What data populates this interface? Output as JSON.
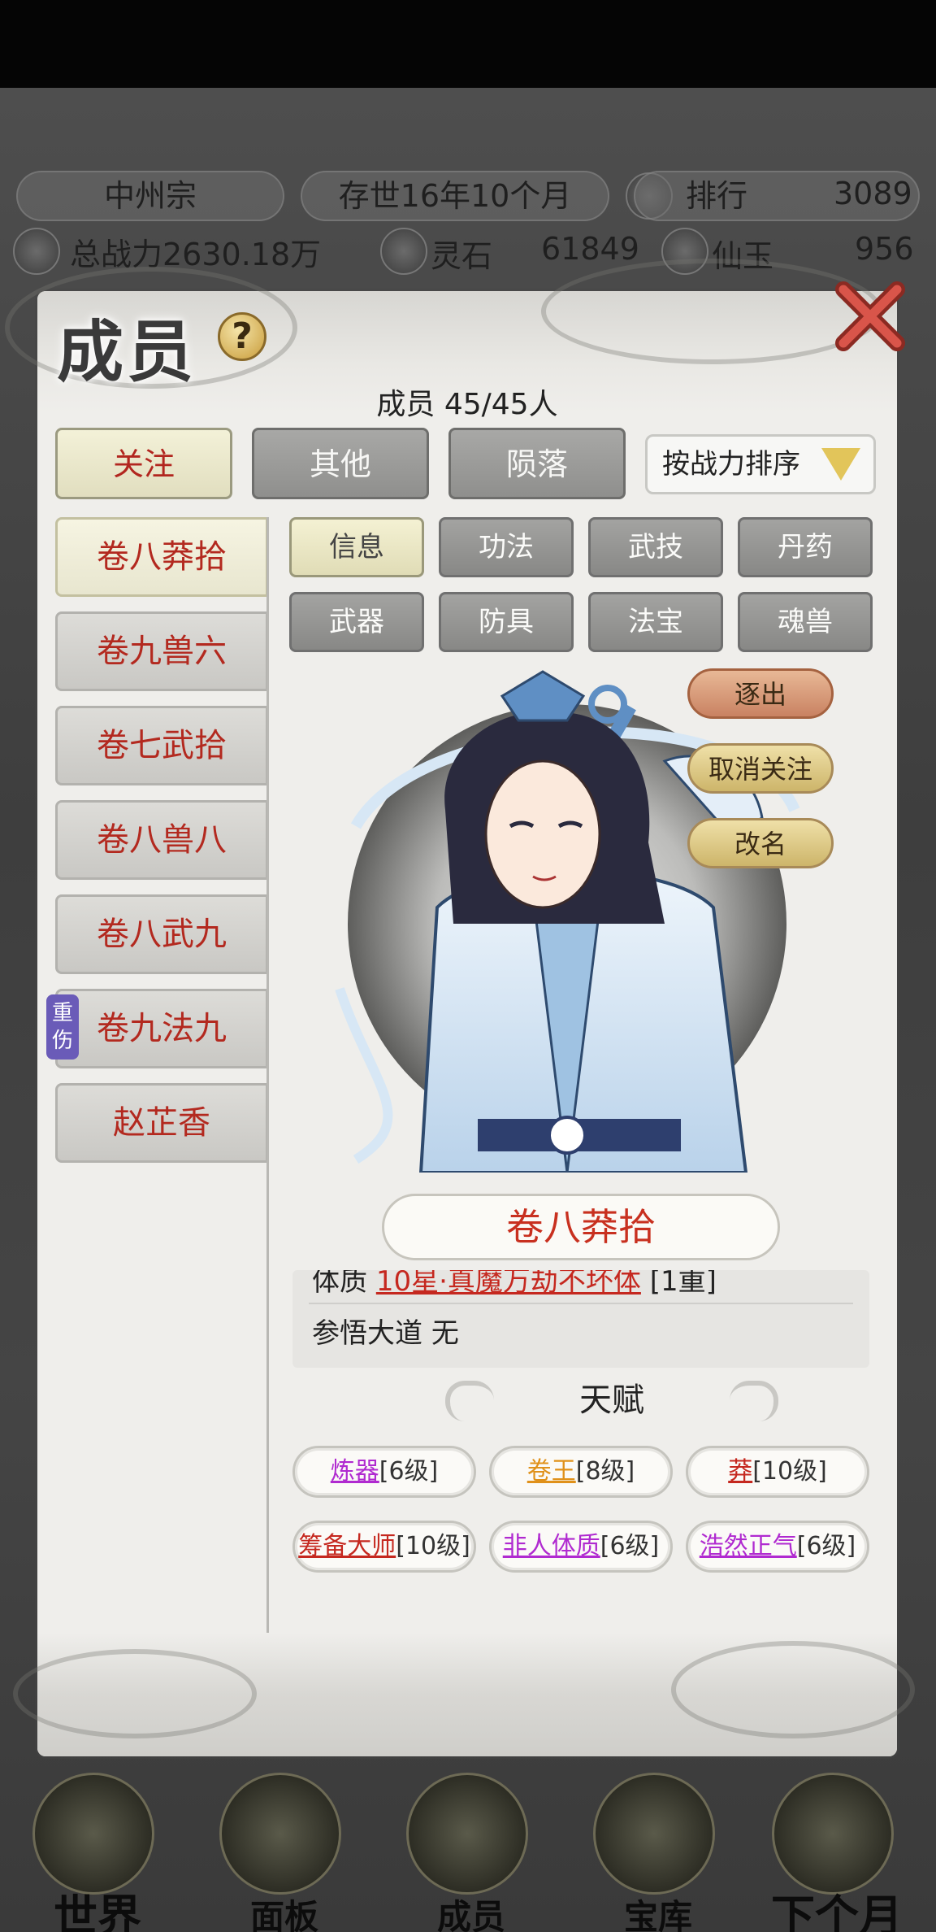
{
  "hud": {
    "sect_name": "中州宗",
    "time": "存世16年10个月",
    "rank_label": "排行",
    "rank_value": "3089",
    "power_label": "总战力2630.18万",
    "spirit_stone_label": "灵石",
    "spirit_stone_value": "61849",
    "jade_label": "仙玉",
    "jade_value": "956"
  },
  "dialog": {
    "title": "成员",
    "help": "?",
    "member_count": "成员  45/45人",
    "tabs": [
      "关注",
      "其他",
      "陨落"
    ],
    "active_tab": "关注",
    "sort_label": "按战力排序"
  },
  "members": [
    {
      "name": "卷八莽拾",
      "selected": true,
      "badge": ""
    },
    {
      "name": "卷九兽六",
      "selected": false,
      "badge": ""
    },
    {
      "name": "卷七武拾",
      "selected": false,
      "badge": ""
    },
    {
      "name": "卷八兽八",
      "selected": false,
      "badge": ""
    },
    {
      "name": "卷八武九",
      "selected": false,
      "badge": ""
    },
    {
      "name": "卷九法九",
      "selected": false,
      "badge": "重伤"
    },
    {
      "name": "赵芷香",
      "selected": false,
      "badge": ""
    }
  ],
  "info_tabs": [
    "信息",
    "功法",
    "武技",
    "丹药",
    "武器",
    "防具",
    "法宝",
    "魂兽"
  ],
  "active_info_tab": "信息",
  "actions": {
    "expel": "逐出",
    "unfollow": "取消关注",
    "rename": "改名"
  },
  "selected_member": {
    "name": "卷八莽拾",
    "constitution_label": "体质",
    "constitution_value": "10星·真魔万劫不坏体",
    "constitution_suffix": "[1重]",
    "dao_label": "参悟大道",
    "dao_value": "无"
  },
  "talent": {
    "title": "天赋",
    "items": [
      {
        "name": "炼器",
        "level": "[6级]",
        "color": "#b02ad0"
      },
      {
        "name": "卷王",
        "level": "[8级]",
        "color": "#e0911a"
      },
      {
        "name": "莽",
        "level": "[10级]",
        "color": "#c5281f"
      },
      {
        "name": "筹备大师",
        "level": "[10级]",
        "color": "#c5281f"
      },
      {
        "name": "非人体质",
        "level": "[6级]",
        "color": "#b02ad0"
      },
      {
        "name": "浩然正气",
        "level": "[6级]",
        "color": "#b02ad0"
      }
    ]
  },
  "bottom_nav": [
    "世界",
    "面板",
    "成员",
    "宝库",
    "下个月"
  ],
  "colors": {
    "accent_red": "#c5281f",
    "talent_purple": "#b02ad0",
    "talent_orange": "#e0911a",
    "injury_badge": "#6a5bb8"
  }
}
